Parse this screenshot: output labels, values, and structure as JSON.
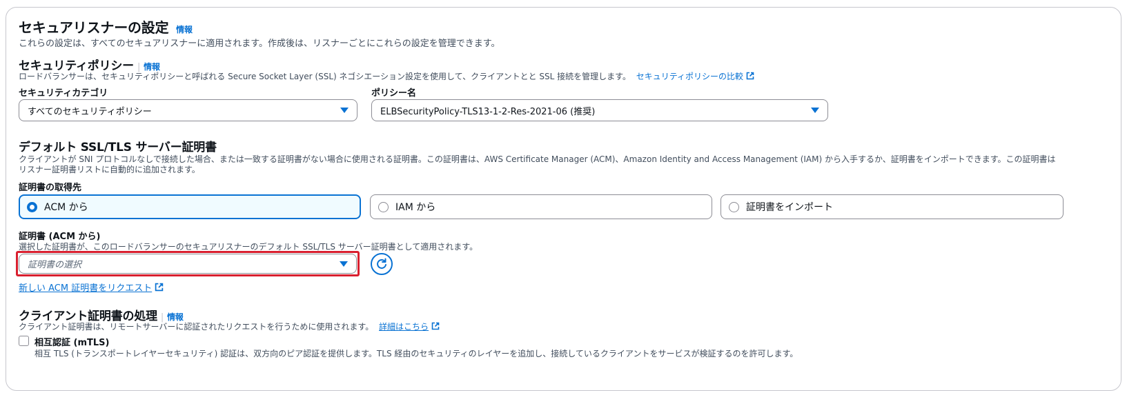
{
  "section": {
    "title": "セキュアリスナーの設定",
    "info": "情報",
    "description": "これらの設定は、すべてのセキュアリスナーに適用されます。作成後は、リスナーごとにこれらの設定を管理できます。"
  },
  "security_policy": {
    "title": "セキュリティポリシー",
    "info": "情報",
    "description": "ロードバランサーは、セキュリティポリシーと呼ばれる Secure Socket Layer (SSL) ネゴシエーション設定を使用して、クライアントとと SSL 接続を管理します。",
    "compare_link": "セキュリティポリシーの比較",
    "category_label": "セキュリティカテゴリ",
    "category_value": "すべてのセキュリティポリシー",
    "policy_label": "ポリシー名",
    "policy_value": "ELBSecurityPolicy-TLS13-1-2-Res-2021-06 (推奨)"
  },
  "default_cert": {
    "title": "デフォルト SSL/TLS サーバー証明書",
    "description": "クライアントが SNI プロトコルなしで接続した場合、または一致する証明書がない場合に使用される証明書。この証明書は、AWS Certificate Manager (ACM)、Amazon Identity and Access Management (IAM) から入手するか、証明書をインポートできます。この証明書はリスナー証明書リストに自動的に追加されます。",
    "source_label": "証明書の取得先",
    "options": [
      "ACM から",
      "IAM から",
      "証明書をインポート"
    ],
    "cert_label": "証明書 (ACM から)",
    "cert_description": "選択した証明書が、このロードバランサーのセキュアリスナーのデフォルト SSL/TLS サーバー証明書として適用されます。",
    "cert_placeholder": "証明書の選択",
    "request_link": "新しい ACM 証明書をリクエスト"
  },
  "client_cert": {
    "title": "クライアント証明書の処理",
    "info": "情報",
    "description": "クライアント証明書は、リモートサーバーに認証されたリクエストを行うために使用されます。",
    "details_link": "詳細はこちら",
    "mtls_label": "相互認証 (mTLS)",
    "mtls_description": "相互 TLS (トランスポートレイヤーセキュリティ) 認証は、双方向のピア認証を提供します。TLS 経由のセキュリティのレイヤーを追加し、接続しているクライアントをサービスが検証するのを許可します。"
  },
  "colors": {
    "accent": "#0972d3",
    "highlight": "#d91f2f"
  }
}
